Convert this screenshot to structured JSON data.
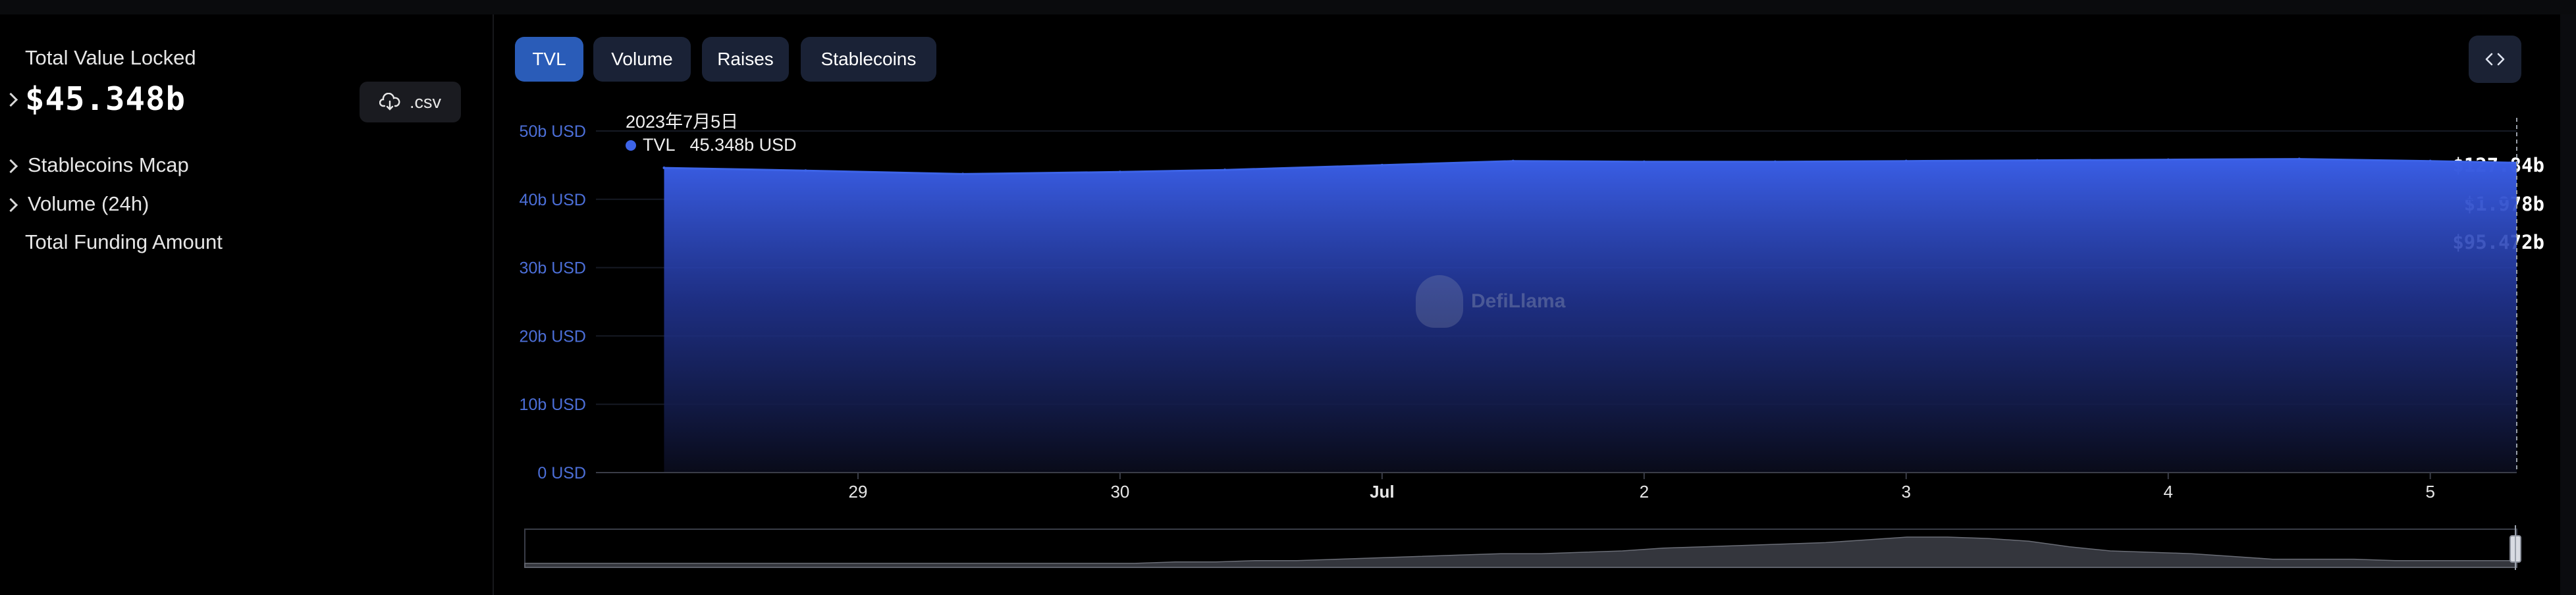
{
  "stats": {
    "tvl_label": "Total Value Locked",
    "tvl_value": "$45.348b",
    "csv_label": ".csv",
    "rows": [
      {
        "label": "Stablecoins Mcap",
        "value": "$127.84b",
        "expandable": true
      },
      {
        "label": "Volume (24h)",
        "value": "$1.978b",
        "expandable": true
      },
      {
        "label": "Total Funding Amount",
        "value": "$95.472b",
        "expandable": false
      }
    ]
  },
  "tabs": [
    {
      "label": "TVL",
      "active": true
    },
    {
      "label": "Volume",
      "active": false
    },
    {
      "label": "Raises",
      "active": false
    },
    {
      "label": "Stablecoins",
      "active": false
    }
  ],
  "embed_icon": "code-icon",
  "tooltip": {
    "date": "2023年7月5日",
    "series_label": "TVL",
    "series_value": "45.348b USD"
  },
  "watermark": "DefiLlama",
  "colors": {
    "accent": "#2a5cb8",
    "series": "#3d64e8",
    "axis_label": "#4c6fd8"
  },
  "chart_data": {
    "type": "area",
    "y_ticks": [
      "50b USD",
      "40b USD",
      "30b USD",
      "20b USD",
      "10b USD",
      "0 USD"
    ],
    "y_tick_values": [
      50,
      40,
      30,
      20,
      10,
      0
    ],
    "ylim": [
      0,
      50
    ],
    "x_ticks": [
      {
        "label": "29",
        "x": 29.0,
        "bold": false
      },
      {
        "label": "30",
        "x": 30.0,
        "bold": false
      },
      {
        "label": "Jul",
        "x": 31.0,
        "bold": true
      },
      {
        "label": "2",
        "x": 32.0,
        "bold": false
      },
      {
        "label": "3",
        "x": 33.0,
        "bold": false
      },
      {
        "label": "4",
        "x": 34.0,
        "bold": false
      },
      {
        "label": "5",
        "x": 35.0,
        "bold": false
      }
    ],
    "xlim": [
      28.0,
      35.33
    ],
    "series": [
      {
        "name": "TVL",
        "x": [
          28.26,
          28.8,
          29.4,
          30.0,
          30.4,
          31.0,
          31.5,
          32.0,
          32.5,
          33.0,
          33.5,
          34.0,
          34.5,
          35.0,
          35.33
        ],
        "values": [
          44.6,
          44.2,
          43.7,
          44.0,
          44.3,
          45.0,
          45.6,
          45.5,
          45.5,
          45.6,
          45.7,
          45.8,
          45.9,
          45.6,
          45.348
        ]
      }
    ],
    "overview": {
      "values": [
        1,
        1,
        1,
        1,
        1,
        1,
        1,
        1,
        1,
        1,
        1,
        1,
        1,
        1,
        1,
        1,
        2,
        2,
        3,
        3,
        4,
        5,
        6,
        7,
        8,
        8,
        9,
        10,
        12,
        13,
        14,
        15,
        16,
        18,
        20,
        20,
        19,
        17,
        13,
        10,
        9,
        8,
        6,
        4,
        4,
        4,
        3,
        3,
        3,
        3
      ]
    },
    "grid": true
  }
}
